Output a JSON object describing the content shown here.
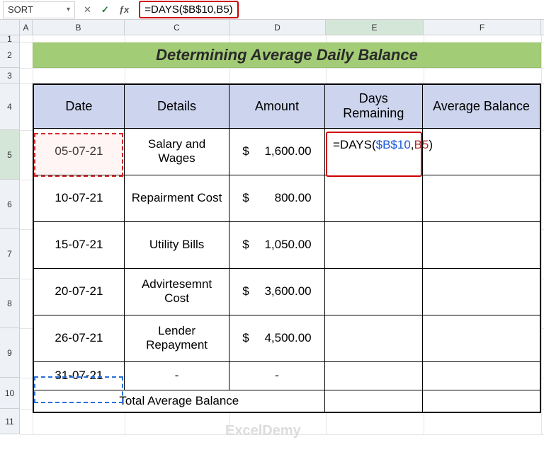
{
  "nameBox": "SORT",
  "formulaBar": "=DAYS($B$10,B5)",
  "columns": {
    "A": "A",
    "B": "B",
    "C": "C",
    "D": "D",
    "E": "E",
    "F": "F"
  },
  "rows": {
    "r1": "1",
    "r2": "2",
    "r3": "3",
    "r4": "4",
    "r5": "5",
    "r6": "6",
    "r7": "7",
    "r8": "8",
    "r9": "9",
    "r10": "10",
    "r11": "11"
  },
  "title": "Determining Average Daily Balance",
  "headers": {
    "date": "Date",
    "details": "Details",
    "amount": "Amount",
    "days": "Days Remaining",
    "avg": "Average Balance"
  },
  "rowsData": [
    {
      "date": "05-07-21",
      "details": "Salary and Wages",
      "currency": "$",
      "amount": "1,600.00"
    },
    {
      "date": "10-07-21",
      "details": "Repairment Cost",
      "currency": "$",
      "amount": "800.00"
    },
    {
      "date": "15-07-21",
      "details": "Utility Bills",
      "currency": "$",
      "amount": "1,050.00"
    },
    {
      "date": "20-07-21",
      "details": "Advirtesemnt Cost",
      "currency": "$",
      "amount": "3,600.00"
    },
    {
      "date": "26-07-21",
      "details": "Lender Repayment",
      "currency": "$",
      "amount": "4,500.00"
    },
    {
      "date": "31-07-21",
      "details": "-",
      "currency": "",
      "amount": "-"
    }
  ],
  "totalLabel": "Total Average Balance",
  "activeCell": {
    "prefix": "=DAYS(",
    "ref1": "$B$10",
    "comma": ",",
    "ref2": "B5",
    "suffix": ")"
  },
  "watermark": "ExcelDemy"
}
